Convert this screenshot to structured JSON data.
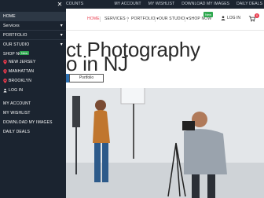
{
  "topbar": {
    "account_fragment": "COUNTS",
    "links": [
      "MY ACCOUNT",
      "MY WISHLIST",
      "DOWNLOAD MY IMAGES",
      "DAILY DEALS"
    ]
  },
  "nav": {
    "items": [
      {
        "label": "HOME",
        "active": true
      },
      {
        "label": "SERVICES ▾",
        "active": false
      },
      {
        "label": "PORTFOLIO ▾",
        "active": false
      },
      {
        "label": "OUR STUDIO ▾",
        "active": false
      },
      {
        "label": "SHOP NOW",
        "active": false
      }
    ],
    "new_badge": "New",
    "login": "LOG IN",
    "cart_count": "0"
  },
  "hero": {
    "line1": "ct Photography",
    "line2": "o in NJ",
    "portfolio_button": "Portfolio"
  },
  "sidebar": {
    "items": [
      {
        "label": "HOME",
        "has_submenu": false
      },
      {
        "label": "Services",
        "has_submenu": true
      },
      {
        "label": "PORTFOLIO",
        "has_submenu": true
      },
      {
        "label": "OUR STUDIO",
        "has_submenu": true
      }
    ],
    "shop_now": "SHOP NOW",
    "new_badge": "New",
    "locations": [
      "NEW JERSEY",
      "MANHATTAN",
      "BROOKLYN"
    ],
    "login": "LOG IN",
    "links": [
      "MY ACCOUNT",
      "MY WISHLIST",
      "DOWNLOAD MY IMAGES",
      "DAILY DEALS"
    ]
  },
  "colors": {
    "sidebar_bg": "#1b2430",
    "accent_red": "#e8394b",
    "badge_green": "#2fa84f",
    "button_blue": "#2b6fb1"
  }
}
